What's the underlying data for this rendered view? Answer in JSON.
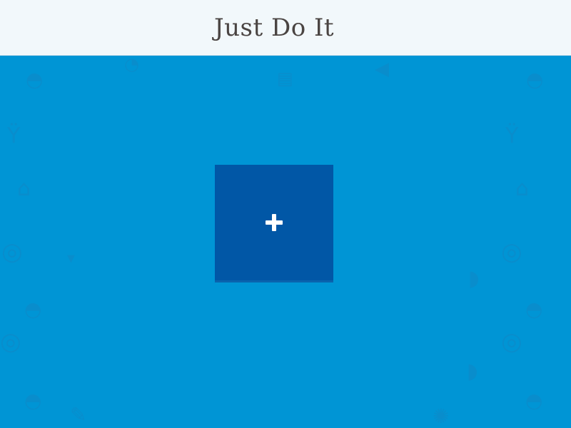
{
  "header": {
    "title": "Just Do It"
  },
  "main": {
    "add_tile": {
      "icon": "plus-icon"
    }
  },
  "background_icons": [
    "cake-icon",
    "cupcake-icon",
    "pizza-slice-icon",
    "cocktail-glass-icon",
    "grill-icon",
    "donut-icon",
    "ice-cream-icon",
    "carrot-icon",
    "bread-icon"
  ],
  "colors": {
    "header_background": "#f2f8fb",
    "title_text": "#4a4442",
    "page_background": "#0095d5",
    "pattern_icon": "#0a8dcc",
    "add_tile_background": "#0157a6",
    "plus_icon": "#ffffff"
  }
}
